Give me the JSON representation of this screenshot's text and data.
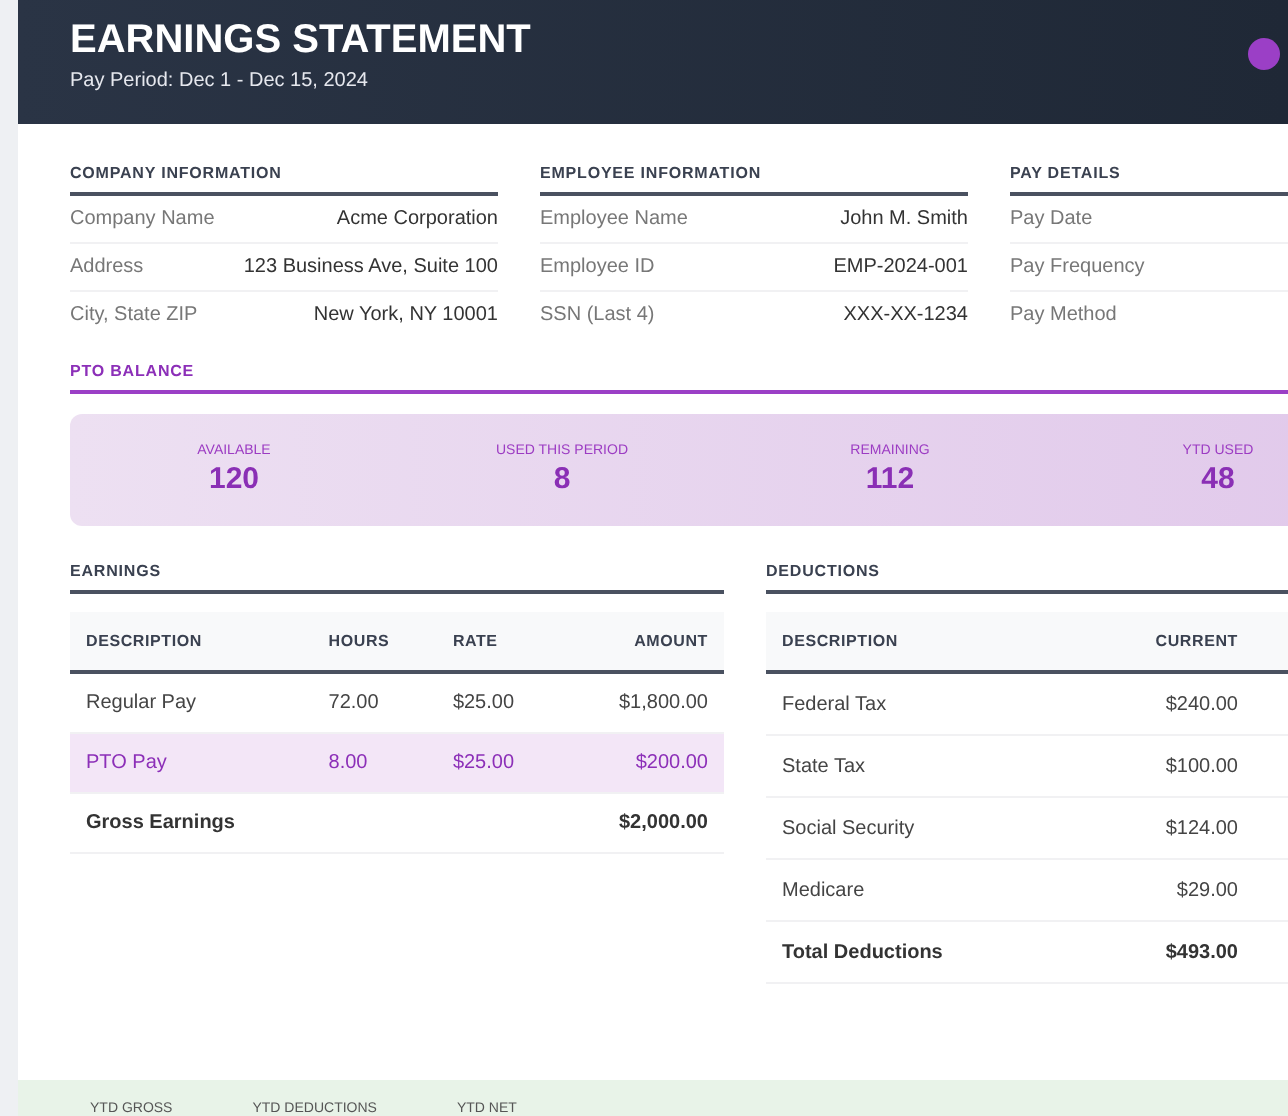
{
  "header": {
    "title": "EARNINGS STATEMENT",
    "pay_period": "Pay Period: Dec 1 - Dec 15, 2024"
  },
  "info_sections": [
    {
      "title": "COMPANY INFORMATION",
      "rows": [
        {
          "label": "Company Name",
          "value": "Acme Corporation"
        },
        {
          "label": "Address",
          "value": "123 Business Ave, Suite 100"
        },
        {
          "label": "City, State ZIP",
          "value": "New York, NY 10001"
        }
      ]
    },
    {
      "title": "EMPLOYEE INFORMATION",
      "rows": [
        {
          "label": "Employee Name",
          "value": "John M. Smith"
        },
        {
          "label": "Employee ID",
          "value": "EMP-2024-001"
        },
        {
          "label": "SSN (Last 4)",
          "value": "XXX-XX-1234"
        }
      ]
    },
    {
      "title": "PAY DETAILS",
      "rows": [
        {
          "label": "Pay Date"
        },
        {
          "label": "Pay Frequency"
        },
        {
          "label": "Pay Method"
        }
      ]
    }
  ],
  "pto_balance": {
    "title": "PTO BALANCE",
    "items": [
      {
        "label": "AVAILABLE",
        "value": "120"
      },
      {
        "label": "USED THIS PERIOD",
        "value": "8"
      },
      {
        "label": "REMAINING",
        "value": "112"
      },
      {
        "label": "YTD USED",
        "value": "48"
      }
    ]
  },
  "earnings": {
    "title": "EARNINGS",
    "columns": [
      "DESCRIPTION",
      "HOURS",
      "RATE",
      "AMOUNT"
    ],
    "rows": [
      {
        "kind": "regular",
        "cells": [
          "Regular Pay",
          "72.00",
          "$25.00",
          "$1,800.00"
        ]
      },
      {
        "kind": "pto",
        "cells": [
          "PTO Pay",
          "8.00",
          "$25.00",
          "$200.00"
        ]
      },
      {
        "kind": "total",
        "cells": [
          "Gross Earnings",
          "",
          "",
          "$2,000.00"
        ]
      }
    ]
  },
  "deductions": {
    "title": "DEDUCTIONS",
    "columns": [
      "DESCRIPTION",
      "CURRENT"
    ],
    "rows": [
      {
        "kind": "regular",
        "cells": [
          "Federal Tax",
          "$240.00"
        ]
      },
      {
        "kind": "regular",
        "cells": [
          "State Tax",
          "$100.00"
        ]
      },
      {
        "kind": "regular",
        "cells": [
          "Social Security",
          "$124.00"
        ]
      },
      {
        "kind": "regular",
        "cells": [
          "Medicare",
          "$29.00"
        ]
      },
      {
        "kind": "total",
        "cells": [
          "Total Deductions",
          "$493.00"
        ]
      }
    ]
  },
  "ytd_summary": [
    "YTD GROSS",
    "YTD DEDUCTIONS",
    "YTD NET"
  ]
}
